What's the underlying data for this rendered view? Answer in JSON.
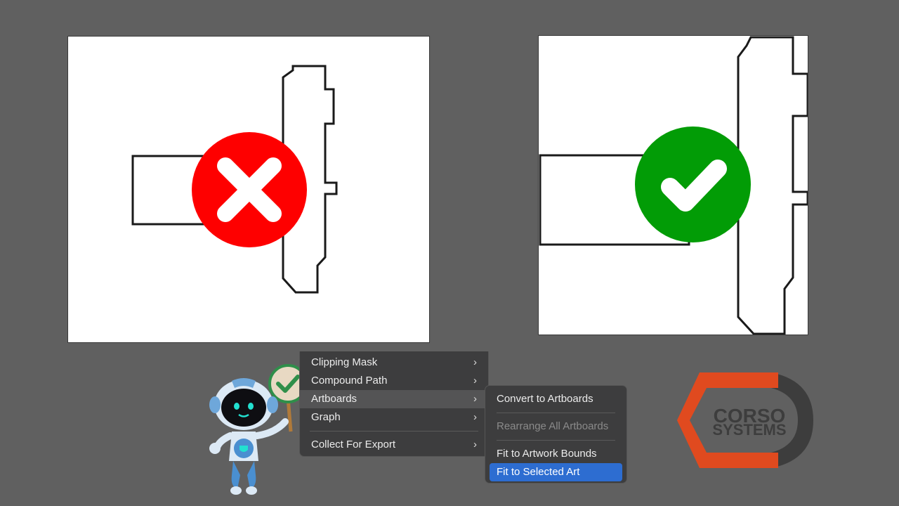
{
  "menu": {
    "items": [
      {
        "label": "Clipping Mask",
        "submenu": true
      },
      {
        "label": "Compound Path",
        "submenu": true
      },
      {
        "label": "Artboards",
        "submenu": true,
        "highlighted": true
      },
      {
        "label": "Graph",
        "submenu": true
      },
      {
        "label": "Collect For Export",
        "submenu": true
      }
    ],
    "chevron": "›"
  },
  "submenu": {
    "items": [
      {
        "label": "Convert to Artboards",
        "state": "enabled"
      },
      {
        "label": "Rearrange All Artboards",
        "state": "disabled"
      },
      {
        "label": "Fit to Artwork Bounds",
        "state": "enabled"
      },
      {
        "label": "Fit to Selected Art",
        "state": "selected"
      }
    ]
  },
  "logo": {
    "line1": "CORSO",
    "line2": "SYSTEMS"
  },
  "colors": {
    "background": "#606060",
    "wrong": "#fe0000",
    "correct": "#029c06",
    "selected": "#2d6dd1",
    "logo_orange": "#e04a1f",
    "logo_dark": "#3d3d3d"
  },
  "icons": {
    "wrong": "x-icon",
    "correct": "checkmark-icon",
    "mascot": "robot-mascot-icon"
  }
}
